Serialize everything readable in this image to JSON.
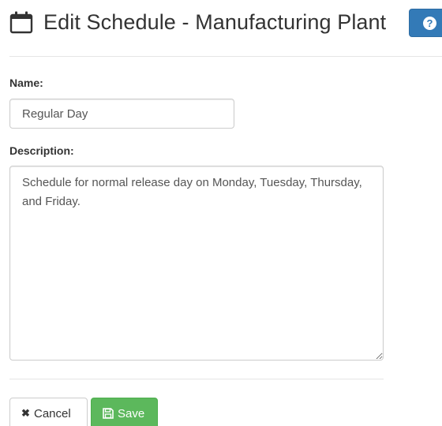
{
  "header": {
    "title": "Edit Schedule - Manufacturing Plant",
    "title_icon": "calendar-icon",
    "help_icon": "question-circle-icon",
    "help_icon_glyph": "?"
  },
  "form": {
    "name_label": "Name:",
    "name_value": "Regular Day",
    "description_label": "Description:",
    "description_value": "Schedule for normal release day on Monday, Tuesday, Thursday, and Friday."
  },
  "actions": {
    "cancel_label": "Cancel",
    "cancel_icon": "times-icon",
    "cancel_icon_glyph": "✖",
    "save_label": "Save",
    "save_icon": "floppy-disk-icon"
  },
  "colors": {
    "primary": "#337ab7",
    "success": "#5cb85c",
    "text": "#333333",
    "border": "#cccccc"
  }
}
